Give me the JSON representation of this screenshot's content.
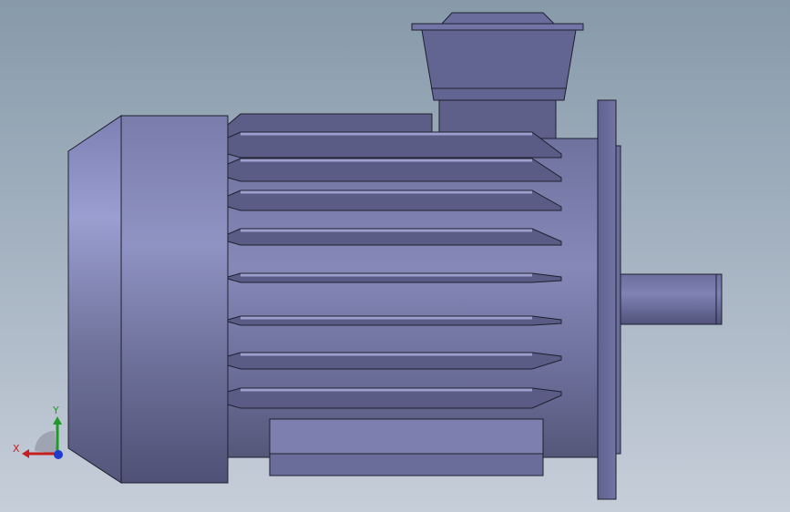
{
  "viewport": {
    "background_top": "#879aaa",
    "background_bottom": "#c6ced9"
  },
  "model": {
    "part": "electric-motor",
    "fin_count": 8,
    "colors": {
      "body": "#6c6e99",
      "body_light": "#8f93c4",
      "body_dark": "#4c4e72",
      "fin_face": "#5a5c85",
      "fin_top": "#9da0cf",
      "edge": "#1e2030"
    }
  },
  "triad": {
    "x_label": "X",
    "y_label": "Y",
    "x_color": "#c42020",
    "y_color": "#1f9a2a",
    "z_color": "#1f3ccf",
    "icon": "coordinate-triad-icon"
  }
}
